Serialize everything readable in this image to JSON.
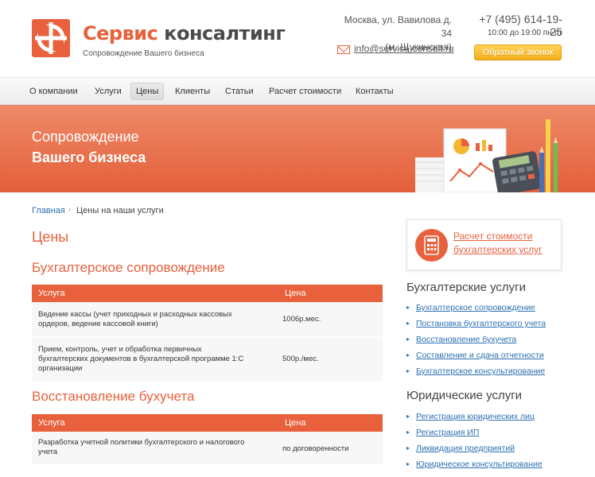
{
  "header": {
    "logo_part1": "Сервис",
    "logo_part2": "консалтинг",
    "tagline": "Сопровождение Вашего бизнеса",
    "address_line1": "Москва, ул. Вавилова д. 34",
    "address_line2": "(м. Щукинская)",
    "email": "info@service-consult.ru",
    "phone": "+7 (495) 614-19-25",
    "hours": "10:00 до 19:00 пн-пт",
    "callback_label": "Обратный звонок"
  },
  "nav": {
    "items": [
      {
        "label": "О компании"
      },
      {
        "label": "Услуги"
      },
      {
        "label": "Цены"
      },
      {
        "label": "Клиенты"
      },
      {
        "label": "Статьи"
      },
      {
        "label": "Расчет стоимости"
      },
      {
        "label": "Контакты"
      }
    ],
    "active_index": 2
  },
  "banner": {
    "line1": "Сопровождение",
    "line2": "Вашего бизнеса"
  },
  "breadcrumb": {
    "home": "Главная",
    "separator": "›",
    "current": "Цены на наши услуги"
  },
  "main": {
    "title": "Цены",
    "sections": [
      {
        "title": "Бухгалтерское сопровождение",
        "col_service": "Услуга",
        "col_price": "Цена",
        "rows": [
          {
            "service_l1": "Ведение кассы (учет приходных и расходных кассовых",
            "service_l2": "ордеров, ведение кассовой книги)",
            "service_l3": "",
            "price": "1006р.мес."
          },
          {
            "service_l1": "Прием, контроль, учет и обработка первичных",
            "service_l2": "бухгалтерских документов в бухгалтерской программе 1:С",
            "service_l3": "организации",
            "price": "500р./мес."
          }
        ]
      },
      {
        "title": "Восстановление бухучета",
        "col_service": "Услуга",
        "col_price": "Цена",
        "rows": [
          {
            "service_l1": "Разработка учетной политики бухгалтерского и налогового",
            "service_l2": "учета",
            "service_l3": "",
            "price": "по договоренности"
          }
        ]
      }
    ]
  },
  "sidebar": {
    "calc_l1": "Расчет стоимости",
    "calc_l2": "бухгалтерских услуг",
    "groups": [
      {
        "title": "Бухгалтерские услуги",
        "links": [
          "Бухгалтерское сопровождение",
          "Постановка бухгалтерского учета",
          "Восстановление бухучета",
          "Составление и сдача отчетности",
          "Бухгалтерское консультирование"
        ]
      },
      {
        "title": "Юридические услуги",
        "links": [
          "Регистрация юридических лиц",
          "Регистрация ИП",
          "Ликвидация предприятий",
          "Юридическое консультирование"
        ]
      }
    ]
  },
  "colors": {
    "accent": "#e8603c",
    "link": "#2a6fb0",
    "button": "#f5ad1a"
  }
}
